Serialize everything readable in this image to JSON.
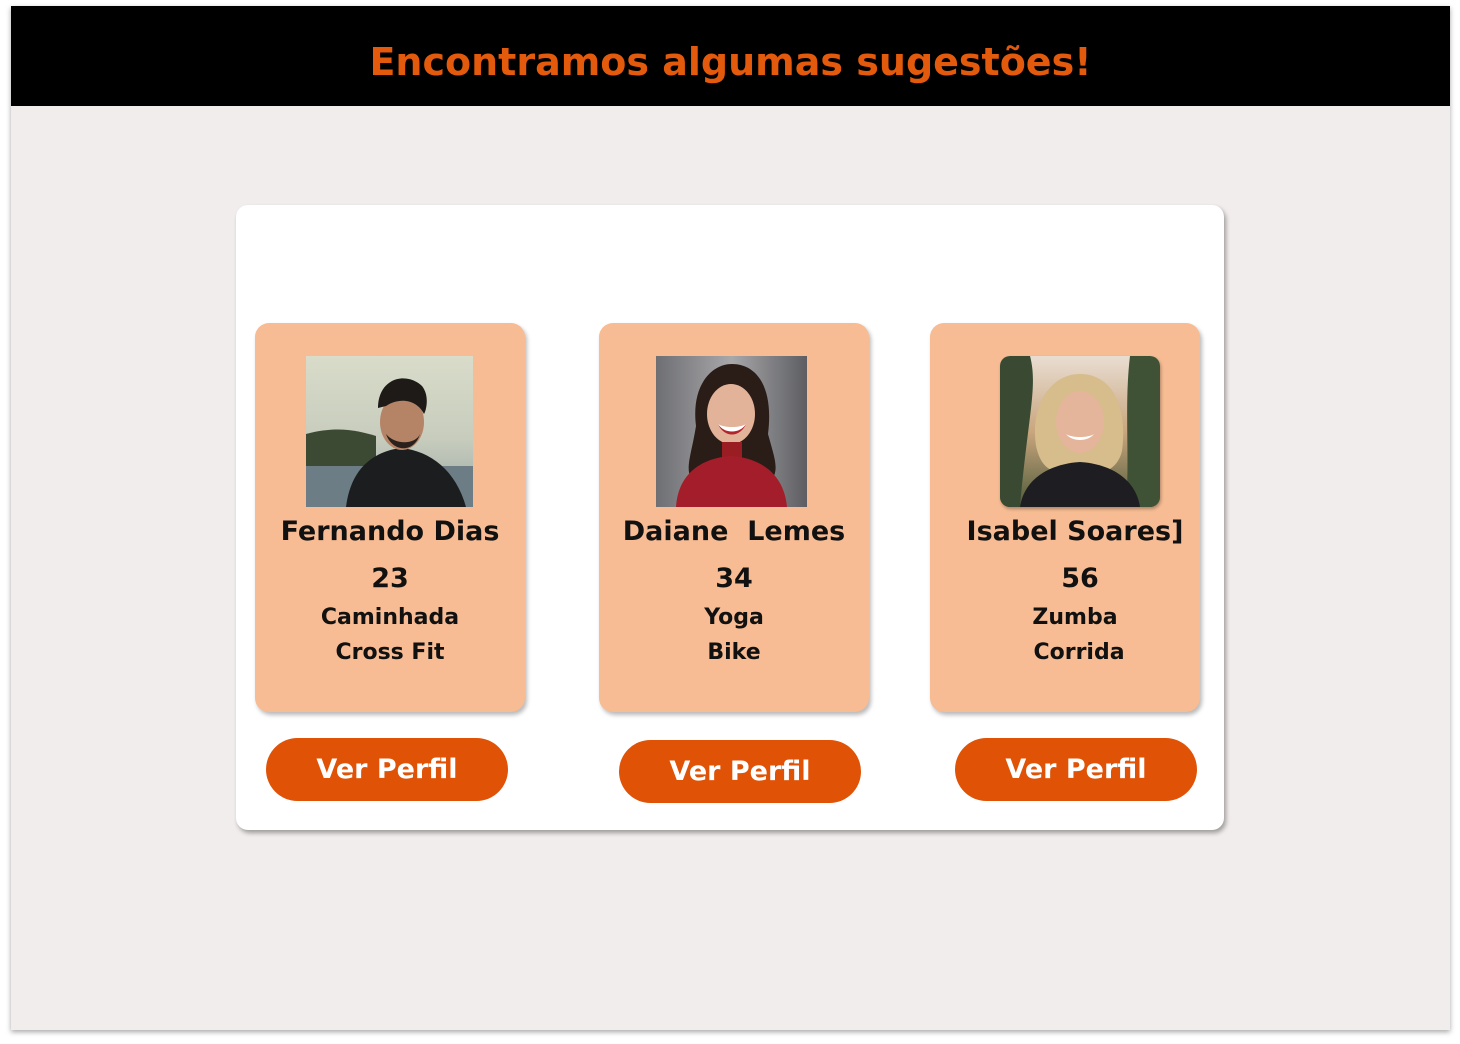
{
  "header": {
    "title": "Encontramos algumas sugestões!"
  },
  "colors": {
    "header_bg": "#000000",
    "title": "#e35a0c",
    "background": "#f2eded",
    "card": "#f7bc93",
    "button": "#e05206",
    "button_text": "#ffffff"
  },
  "suggestions": [
    {
      "name": "Fernando Dias",
      "age": "23",
      "activities": [
        "Caminhada",
        "Cross Fit"
      ],
      "button_label": "Ver Perfil",
      "photo": "man-portrait"
    },
    {
      "name": "Daiane  Lemes",
      "age": "34",
      "activities": [
        "Yoga",
        "Bike"
      ],
      "button_label": "Ver Perfil",
      "photo": "woman-portrait-red-sweater"
    },
    {
      "name": "Isabel Soares]",
      "age": "56",
      "activities": [
        "Zumba",
        "Corrida"
      ],
      "button_label": "Ver Perfil",
      "photo": "woman-portrait-blonde"
    }
  ]
}
